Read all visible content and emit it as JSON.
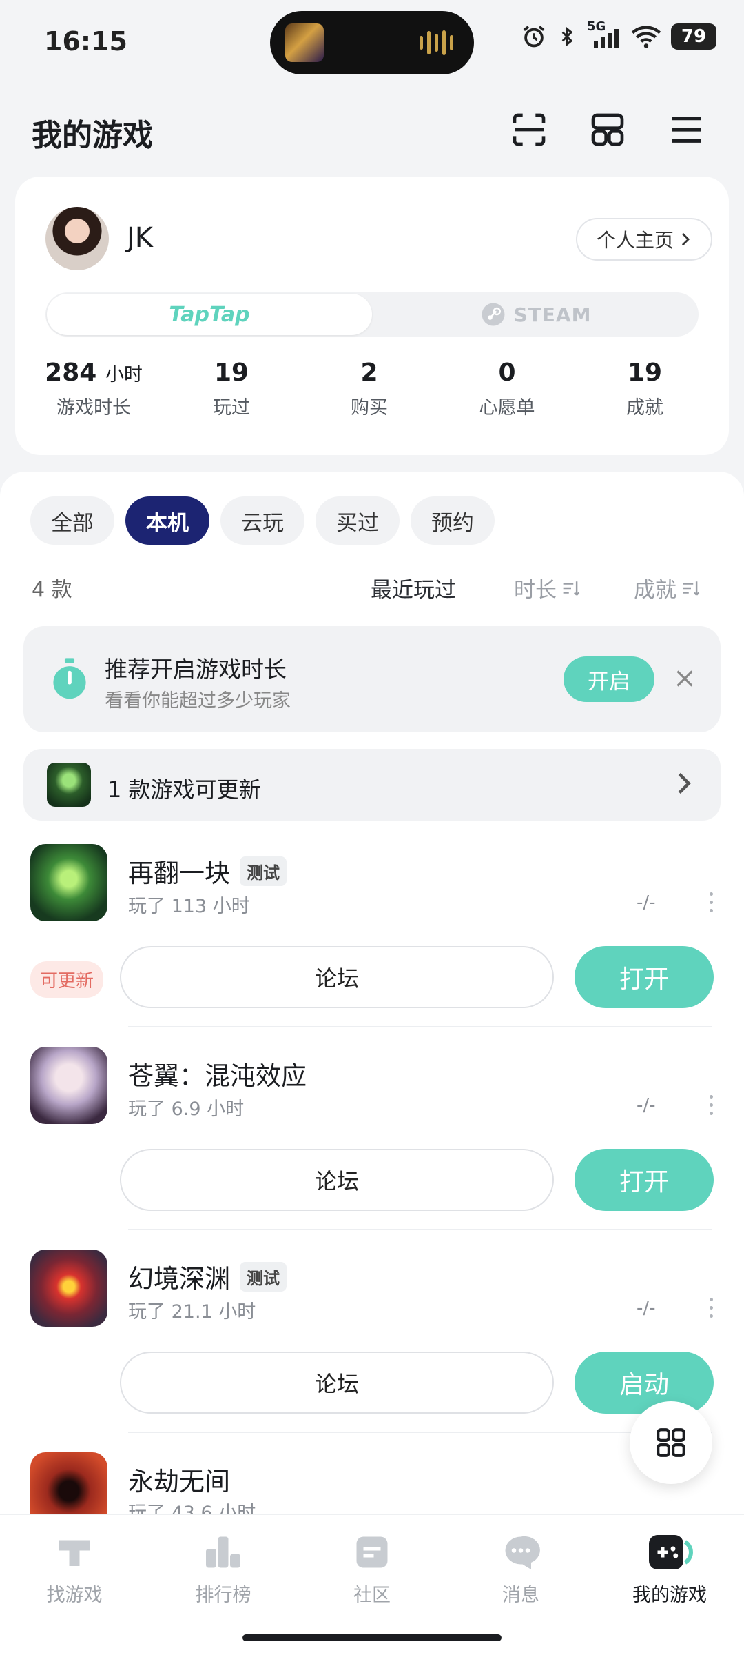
{
  "status_bar": {
    "time": "16:15",
    "network": "5G",
    "battery": "79"
  },
  "header": {
    "title": "我的游戏"
  },
  "profile": {
    "username": "JK",
    "profile_link": "个人主页",
    "platforms": {
      "taptap": "TapTap",
      "steam": "STEAM"
    },
    "stats": [
      {
        "value": "284",
        "unit": "小时",
        "label": "游戏时长"
      },
      {
        "value": "19",
        "unit": "",
        "label": "玩过"
      },
      {
        "value": "2",
        "unit": "",
        "label": "购买"
      },
      {
        "value": "0",
        "unit": "",
        "label": "心愿单"
      },
      {
        "value": "19",
        "unit": "",
        "label": "成就"
      }
    ]
  },
  "filters": [
    "全部",
    "本机",
    "云玩",
    "买过",
    "预约"
  ],
  "list_meta": {
    "count": "4 款",
    "sorts": [
      "最近玩过",
      "时长",
      "成就"
    ]
  },
  "recommendation": {
    "title": "推荐开启游戏时长",
    "subtitle": "看看你能超过多少玩家",
    "button": "开启"
  },
  "update_banner": {
    "text": "1 款游戏可更新"
  },
  "games": [
    {
      "name": "再翻一块",
      "tag": "测试",
      "playtime": "玩了 113 小时",
      "rating": "-/-",
      "badge": "可更新",
      "forum": "论坛",
      "action": "打开"
    },
    {
      "name": "苍翼：混沌效应",
      "tag": "",
      "playtime": "玩了 6.9 小时",
      "rating": "-/-",
      "badge": "",
      "forum": "论坛",
      "action": "打开"
    },
    {
      "name": "幻境深渊",
      "tag": "测试",
      "playtime": "玩了 21.1 小时",
      "rating": "-/-",
      "badge": "",
      "forum": "论坛",
      "action": "启动"
    },
    {
      "name": "永劫无间",
      "tag": "",
      "playtime": "玩了 43.6 小时",
      "rating": "-/-",
      "badge": "",
      "forum": "",
      "action": ""
    }
  ],
  "bottom_nav": [
    {
      "label": "找游戏",
      "icon": "taptap-t-icon"
    },
    {
      "label": "排行榜",
      "icon": "ranking-icon"
    },
    {
      "label": "社区",
      "icon": "community-icon"
    },
    {
      "label": "消息",
      "icon": "message-icon"
    },
    {
      "label": "我的游戏",
      "icon": "gamepad-icon"
    }
  ],
  "colors": {
    "accent": "#5fd3bd",
    "chip_active": "#1c2472",
    "update_badge": "#e36b62"
  }
}
